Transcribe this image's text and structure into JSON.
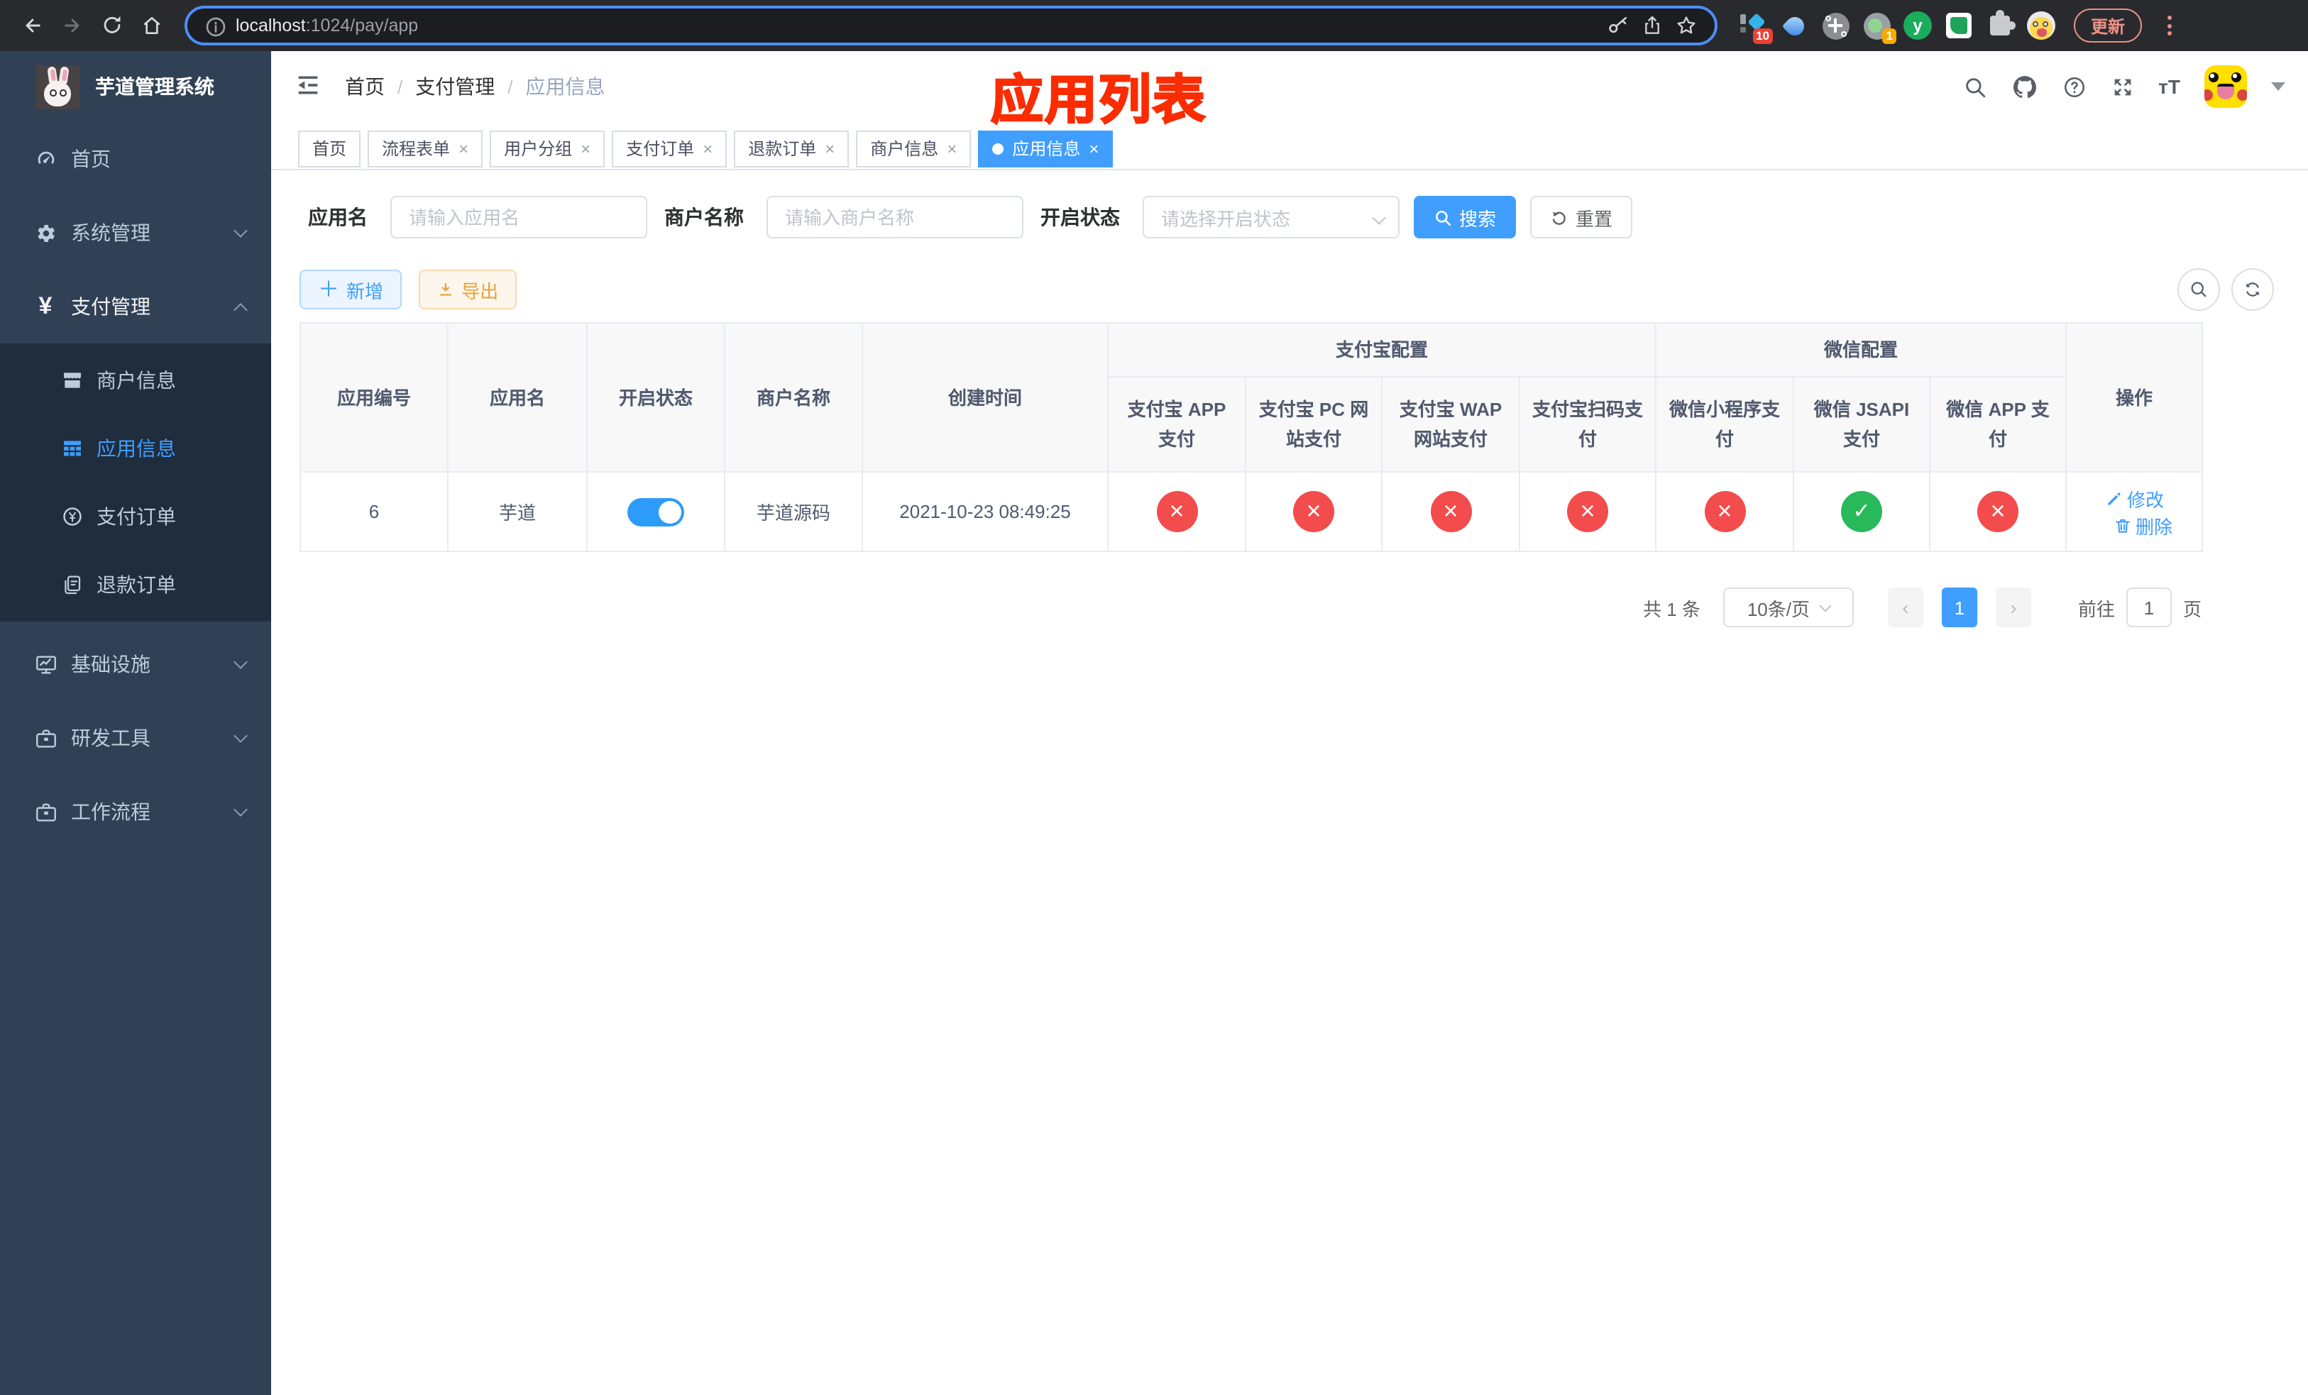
{
  "browser": {
    "url": {
      "host": "localhost",
      "path": ":1024/pay/app"
    },
    "update_button": "更新",
    "extensions": {
      "badge_a": "10",
      "badge_b": "1",
      "letter": "y"
    }
  },
  "sidebar": {
    "title": "芋道管理系统",
    "menu": [
      {
        "label": "首页"
      },
      {
        "label": "系统管理"
      },
      {
        "label": "支付管理"
      },
      {
        "label": "商户信息"
      },
      {
        "label": "应用信息"
      },
      {
        "label": "支付订单"
      },
      {
        "label": "退款订单"
      },
      {
        "label": "基础设施"
      },
      {
        "label": "研发工具"
      },
      {
        "label": "工作流程"
      }
    ]
  },
  "breadcrumb": {
    "items": [
      "首页",
      "支付管理",
      "应用信息"
    ]
  },
  "annotation": "应用列表",
  "tabs": [
    {
      "label": "首页",
      "closable": false,
      "active": false
    },
    {
      "label": "流程表单",
      "closable": true,
      "active": false
    },
    {
      "label": "用户分组",
      "closable": true,
      "active": false
    },
    {
      "label": "支付订单",
      "closable": true,
      "active": false
    },
    {
      "label": "退款订单",
      "closable": true,
      "active": false
    },
    {
      "label": "商户信息",
      "closable": true,
      "active": false
    },
    {
      "label": "应用信息",
      "closable": true,
      "active": true
    }
  ],
  "filters": {
    "app_name_label": "应用名",
    "app_name_placeholder": "请输入应用名",
    "merchant_label": "商户名称",
    "merchant_placeholder": "请输入商户名称",
    "status_label": "开启状态",
    "status_placeholder": "请选择开启状态",
    "search_button": "搜索",
    "reset_button": "重置"
  },
  "toolbar": {
    "add_button": "新增",
    "export_button": "导出"
  },
  "table": {
    "columns": {
      "app_id": "应用编号",
      "app_name": "应用名",
      "open_status": "开启状态",
      "merchant_name": "商户名称",
      "create_time": "创建时间",
      "alipay_group": "支付宝配置",
      "wechat_group": "微信配置",
      "alipay_app": "支付宝 APP 支付",
      "alipay_pc": "支付宝 PC 网站支付",
      "alipay_wap": "支付宝 WAP 网站支付",
      "alipay_qr": "支付宝扫码支付",
      "wx_mini": "微信小程序支付",
      "wx_jsapi": "微信 JSAPI 支付",
      "wx_app": "微信 APP 支付",
      "actions": "操作"
    },
    "row": {
      "app_id": "6",
      "app_name": "芋道",
      "open_status": true,
      "merchant_name": "芋道源码",
      "create_time": "2021-10-23 08:49:25",
      "statuses": [
        "error",
        "error",
        "error",
        "error",
        "error",
        "success",
        "error"
      ],
      "edit": "修改",
      "delete": "删除"
    }
  },
  "pagination": {
    "total": "共 1 条",
    "page_size": "10条/页",
    "page": "1",
    "goto_prefix": "前往",
    "goto_value": "1",
    "goto_suffix": "页"
  },
  "colors": {
    "accent": "#409eff",
    "success": "#28b95a",
    "danger": "#f34c4c",
    "warning": "#e6a23c",
    "sidebar_bg": "#304156",
    "submenu_bg": "#1f2d3d"
  }
}
